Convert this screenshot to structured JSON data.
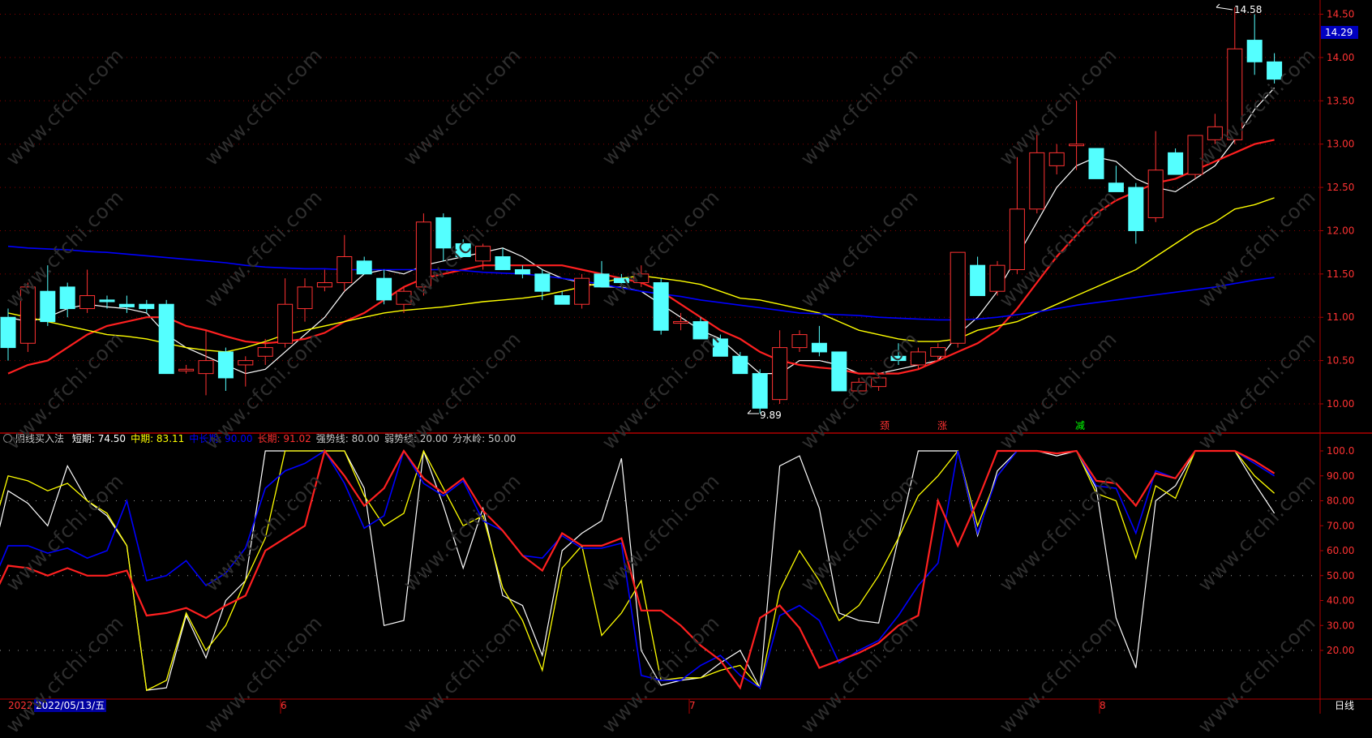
{
  "watermark": "www.cfchi.com",
  "price_axis": {
    "ticks": [
      "14.50",
      "14.00",
      "13.50",
      "13.00",
      "12.50",
      "12.00",
      "11.50",
      "11.00",
      "10.50",
      "10.00"
    ],
    "current": "14.29"
  },
  "osc_axis": {
    "ticks": [
      "100.0",
      "90.00",
      "80.00",
      "70.00",
      "60.00",
      "50.00",
      "40.00",
      "30.00",
      "20.00"
    ]
  },
  "labels": {
    "high": "14.58",
    "low": "9.89"
  },
  "signals": [
    "颈",
    "涨",
    "减"
  ],
  "indicator": {
    "name": "阴线买入法",
    "items": [
      {
        "label": "短期:",
        "value": "74.50",
        "color": "#ffffff"
      },
      {
        "label": "中期:",
        "value": "83.11",
        "color": "#ffff00"
      },
      {
        "label": "中长期:",
        "value": "90.00",
        "color": "#0000ff"
      },
      {
        "label": "长期:",
        "value": "91.02",
        "color": "#ff3030"
      },
      {
        "label": "强势线:",
        "value": "80.00",
        "color": "#c8c8c8"
      },
      {
        "label": "弱势线:",
        "value": "20.00",
        "color": "#c8c8c8"
      },
      {
        "label": "分水岭:",
        "value": "50.00",
        "color": "#c8c8c8"
      }
    ]
  },
  "footer": {
    "year": "2022",
    "cursor_date": "2022/05/13/五",
    "months": [
      "6",
      "7",
      "8"
    ],
    "period": "日线"
  },
  "colors": {
    "up": "#ff3232",
    "down": "#54ffff",
    "ma5": "#ffffff",
    "ma10": "#ff2020",
    "ma20": "#ffff00",
    "ma60": "#0000ff",
    "grid": "#8b0000"
  },
  "chart_data": [
    {
      "type": "candlestick",
      "title": "",
      "ylim": [
        9.8,
        14.6
      ],
      "candles": [
        {
          "o": 11.0,
          "h": 11.1,
          "l": 10.5,
          "c": 10.65
        },
        {
          "o": 10.7,
          "h": 11.4,
          "l": 10.6,
          "c": 11.35
        },
        {
          "o": 11.3,
          "h": 11.6,
          "l": 10.9,
          "c": 10.95
        },
        {
          "o": 11.35,
          "h": 11.4,
          "l": 11.0,
          "c": 11.1
        },
        {
          "o": 11.1,
          "h": 11.55,
          "l": 11.05,
          "c": 11.25
        },
        {
          "o": 11.2,
          "h": 11.25,
          "l": 11.1,
          "c": 11.18
        },
        {
          "o": 11.15,
          "h": 11.25,
          "l": 11.05,
          "c": 11.12
        },
        {
          "o": 11.15,
          "h": 11.2,
          "l": 11.05,
          "c": 11.1
        },
        {
          "o": 11.15,
          "h": 11.2,
          "l": 10.35,
          "c": 10.35
        },
        {
          "o": 10.4,
          "h": 10.45,
          "l": 10.35,
          "c": 10.4
        },
        {
          "o": 10.35,
          "h": 10.85,
          "l": 10.1,
          "c": 10.5
        },
        {
          "o": 10.6,
          "h": 10.65,
          "l": 10.15,
          "c": 10.3
        },
        {
          "o": 10.45,
          "h": 10.55,
          "l": 10.2,
          "c": 10.5
        },
        {
          "o": 10.55,
          "h": 10.75,
          "l": 10.45,
          "c": 10.65
        },
        {
          "o": 10.7,
          "h": 11.45,
          "l": 10.65,
          "c": 11.15
        },
        {
          "o": 11.1,
          "h": 11.45,
          "l": 10.95,
          "c": 11.35
        },
        {
          "o": 11.35,
          "h": 11.55,
          "l": 11.3,
          "c": 11.4
        },
        {
          "o": 11.4,
          "h": 11.95,
          "l": 11.3,
          "c": 11.7
        },
        {
          "o": 11.65,
          "h": 11.7,
          "l": 11.5,
          "c": 11.5
        },
        {
          "o": 11.45,
          "h": 11.55,
          "l": 11.15,
          "c": 11.2
        },
        {
          "o": 11.15,
          "h": 11.35,
          "l": 11.05,
          "c": 11.3
        },
        {
          "o": 11.35,
          "h": 12.2,
          "l": 11.25,
          "c": 12.1
        },
        {
          "o": 12.15,
          "h": 12.2,
          "l": 11.65,
          "c": 11.8
        },
        {
          "o": 11.85,
          "h": 11.9,
          "l": 11.7,
          "c": 11.7
        },
        {
          "o": 11.65,
          "h": 11.85,
          "l": 11.55,
          "c": 11.82
        },
        {
          "o": 11.7,
          "h": 11.8,
          "l": 11.55,
          "c": 11.55
        },
        {
          "o": 11.55,
          "h": 11.6,
          "l": 11.45,
          "c": 11.5
        },
        {
          "o": 11.5,
          "h": 11.55,
          "l": 11.2,
          "c": 11.3
        },
        {
          "o": 11.25,
          "h": 11.3,
          "l": 11.15,
          "c": 11.15
        },
        {
          "o": 11.15,
          "h": 11.5,
          "l": 11.1,
          "c": 11.45
        },
        {
          "o": 11.5,
          "h": 11.65,
          "l": 11.35,
          "c": 11.35
        },
        {
          "o": 11.45,
          "h": 11.5,
          "l": 11.35,
          "c": 11.4
        },
        {
          "o": 11.4,
          "h": 11.6,
          "l": 11.35,
          "c": 11.5
        },
        {
          "o": 11.4,
          "h": 11.45,
          "l": 10.8,
          "c": 10.85
        },
        {
          "o": 10.95,
          "h": 11.05,
          "l": 10.85,
          "c": 10.95
        },
        {
          "o": 10.95,
          "h": 11.0,
          "l": 10.75,
          "c": 10.75
        },
        {
          "o": 10.75,
          "h": 10.8,
          "l": 10.55,
          "c": 10.55
        },
        {
          "o": 10.55,
          "h": 10.6,
          "l": 10.35,
          "c": 10.35
        },
        {
          "o": 10.35,
          "h": 10.4,
          "l": 9.89,
          "c": 9.95
        },
        {
          "o": 10.05,
          "h": 10.85,
          "l": 10.0,
          "c": 10.65
        },
        {
          "o": 10.65,
          "h": 10.85,
          "l": 10.6,
          "c": 10.8
        },
        {
          "o": 10.7,
          "h": 10.9,
          "l": 10.55,
          "c": 10.6
        },
        {
          "o": 10.6,
          "h": 10.6,
          "l": 10.15,
          "c": 10.15
        },
        {
          "o": 10.15,
          "h": 10.3,
          "l": 10.15,
          "c": 10.25
        },
        {
          "o": 10.2,
          "h": 10.35,
          "l": 10.15,
          "c": 10.3
        },
        {
          "o": 10.55,
          "h": 10.7,
          "l": 10.45,
          "c": 10.5
        },
        {
          "o": 10.45,
          "h": 10.65,
          "l": 10.4,
          "c": 10.6
        },
        {
          "o": 10.55,
          "h": 10.7,
          "l": 10.5,
          "c": 10.65
        },
        {
          "o": 10.7,
          "h": 11.75,
          "l": 10.65,
          "c": 11.75
        },
        {
          "o": 11.6,
          "h": 11.7,
          "l": 11.25,
          "c": 11.25
        },
        {
          "o": 11.3,
          "h": 11.65,
          "l": 11.25,
          "c": 11.6
        },
        {
          "o": 11.55,
          "h": 12.85,
          "l": 11.5,
          "c": 12.25
        },
        {
          "o": 12.25,
          "h": 13.15,
          "l": 12.2,
          "c": 12.9
        },
        {
          "o": 12.75,
          "h": 13.0,
          "l": 12.65,
          "c": 12.9
        },
        {
          "o": 13.0,
          "h": 13.5,
          "l": 12.7,
          "c": 13.0
        },
        {
          "o": 12.95,
          "h": 12.95,
          "l": 12.6,
          "c": 12.6
        },
        {
          "o": 12.55,
          "h": 12.75,
          "l": 12.45,
          "c": 12.45
        },
        {
          "o": 12.5,
          "h": 12.55,
          "l": 11.85,
          "c": 12.0
        },
        {
          "o": 12.15,
          "h": 13.15,
          "l": 12.1,
          "c": 12.7
        },
        {
          "o": 12.9,
          "h": 12.95,
          "l": 12.65,
          "c": 12.65
        },
        {
          "o": 12.65,
          "h": 13.1,
          "l": 12.6,
          "c": 13.1
        },
        {
          "o": 13.05,
          "h": 13.35,
          "l": 13.0,
          "c": 13.2
        },
        {
          "o": 13.05,
          "h": 14.58,
          "l": 13.0,
          "c": 14.1
        },
        {
          "o": 14.2,
          "h": 14.5,
          "l": 13.8,
          "c": 13.95
        },
        {
          "o": 13.95,
          "h": 14.05,
          "l": 13.7,
          "c": 13.75
        }
      ],
      "series": [
        {
          "values": [
            11.0,
            10.95,
            11.0,
            11.1,
            11.15,
            11.12,
            11.1,
            11.05,
            10.8,
            10.65,
            10.55,
            10.45,
            10.35,
            10.4,
            10.6,
            10.8,
            11.0,
            11.3,
            11.5,
            11.55,
            11.5,
            11.6,
            11.65,
            11.7,
            11.75,
            11.8,
            11.7,
            11.55,
            11.45,
            11.4,
            11.35,
            11.35,
            11.3,
            11.15,
            11.0,
            10.85,
            10.75,
            10.55,
            10.35,
            10.35,
            10.5,
            10.5,
            10.45,
            10.35,
            10.35,
            10.4,
            10.45,
            10.5,
            10.8,
            11.0,
            11.3,
            11.7,
            12.1,
            12.5,
            12.75,
            12.85,
            12.8,
            12.6,
            12.5,
            12.45,
            12.6,
            12.75,
            13.05,
            13.4,
            13.65
          ]
        },
        {
          "values": [
            10.35,
            10.45,
            10.5,
            10.65,
            10.8,
            10.9,
            10.95,
            11.0,
            11.0,
            10.9,
            10.85,
            10.78,
            10.72,
            10.7,
            10.72,
            10.75,
            10.82,
            10.95,
            11.05,
            11.2,
            11.35,
            11.45,
            11.5,
            11.55,
            11.6,
            11.6,
            11.6,
            11.6,
            11.6,
            11.55,
            11.5,
            11.45,
            11.4,
            11.3,
            11.15,
            11.0,
            10.85,
            10.75,
            10.6,
            10.5,
            10.45,
            10.42,
            10.4,
            10.35,
            10.35,
            10.35,
            10.4,
            10.5,
            10.6,
            10.7,
            10.85,
            11.1,
            11.4,
            11.7,
            11.95,
            12.2,
            12.35,
            12.45,
            12.55,
            12.6,
            12.7,
            12.8,
            12.9,
            13.0,
            13.05
          ]
        },
        {
          "values": [
            11.05,
            11.0,
            10.95,
            10.9,
            10.85,
            10.8,
            10.78,
            10.75,
            10.7,
            10.65,
            10.62,
            10.6,
            10.65,
            10.72,
            10.8,
            10.85,
            10.9,
            10.95,
            11.0,
            11.05,
            11.08,
            11.1,
            11.12,
            11.15,
            11.18,
            11.2,
            11.22,
            11.25,
            11.3,
            11.35,
            11.4,
            11.45,
            11.48,
            11.45,
            11.42,
            11.38,
            11.3,
            11.22,
            11.2,
            11.15,
            11.1,
            11.05,
            10.95,
            10.85,
            10.8,
            10.75,
            10.72,
            10.72,
            10.75,
            10.85,
            10.9,
            10.95,
            11.05,
            11.15,
            11.25,
            11.35,
            11.45,
            11.55,
            11.7,
            11.85,
            12.0,
            12.1,
            12.25,
            12.3,
            12.38
          ]
        },
        {
          "values": [
            11.82,
            11.8,
            11.79,
            11.78,
            11.76,
            11.75,
            11.73,
            11.71,
            11.69,
            11.67,
            11.65,
            11.63,
            11.6,
            11.58,
            11.57,
            11.56,
            11.56,
            11.55,
            11.55,
            11.55,
            11.55,
            11.55,
            11.55,
            11.54,
            11.52,
            11.51,
            11.5,
            11.48,
            11.45,
            11.42,
            11.38,
            11.34,
            11.3,
            11.27,
            11.24,
            11.2,
            11.17,
            11.14,
            11.11,
            11.08,
            11.05,
            11.04,
            11.03,
            11.02,
            11.0,
            10.99,
            10.98,
            10.97,
            10.97,
            10.98,
            11.0,
            11.03,
            11.06,
            11.1,
            11.14,
            11.17,
            11.2,
            11.23,
            11.26,
            11.29,
            11.32,
            11.35,
            11.39,
            11.43,
            11.46
          ]
        }
      ]
    },
    {
      "type": "line",
      "title": "",
      "ylim": [
        0,
        100
      ],
      "series": [
        {
          "name": "短期",
          "values": [
            50,
            84,
            79,
            70,
            94,
            80,
            74,
            62,
            4,
            5,
            34,
            17,
            40,
            48,
            100,
            100,
            100,
            100,
            100,
            85,
            30,
            32,
            100,
            78,
            53,
            77,
            42,
            38,
            18,
            60,
            67,
            72,
            97,
            20,
            6,
            8,
            9,
            15,
            20,
            5,
            94,
            98,
            77,
            35,
            32,
            31,
            65,
            100,
            100,
            100,
            66,
            92,
            100,
            100,
            98,
            100,
            85,
            33,
            13,
            80,
            86,
            100,
            100,
            100,
            87,
            75
          ]
        },
        {
          "name": "中期",
          "values": [
            62,
            90,
            88,
            84,
            87,
            80,
            75,
            62,
            4,
            8,
            35,
            20,
            30,
            48,
            65,
            100,
            100,
            100,
            100,
            82,
            70,
            75,
            100,
            85,
            70,
            74,
            45,
            32,
            12,
            53,
            62,
            26,
            35,
            48,
            8,
            9,
            9,
            12,
            14,
            5,
            44,
            60,
            48,
            32,
            38,
            50,
            65,
            82,
            90,
            100,
            70,
            90,
            100,
            100,
            99,
            100,
            83,
            80,
            57,
            86,
            81,
            100,
            100,
            100,
            90,
            83
          ]
        },
        {
          "name": "中长期",
          "values": [
            43,
            62,
            62,
            59,
            61,
            57,
            60,
            80,
            48,
            50,
            56,
            46,
            51,
            61,
            85,
            92,
            95,
            100,
            87,
            69,
            74,
            100,
            87,
            82,
            88,
            72,
            68,
            58,
            57,
            66,
            61,
            61,
            63,
            10,
            8,
            8,
            14,
            18,
            10,
            5,
            34,
            38,
            32,
            15,
            20,
            24,
            34,
            46,
            55,
            100,
            67,
            90,
            100,
            100,
            99,
            100,
            86,
            85,
            67,
            92,
            89,
            100,
            100,
            100,
            95,
            90
          ]
        },
        {
          "name": "长期",
          "values": [
            37,
            54,
            53,
            50,
            53,
            50,
            50,
            52,
            34,
            35,
            37,
            33,
            38,
            42,
            60,
            65,
            70,
            100,
            90,
            78,
            85,
            100,
            89,
            83,
            89,
            76,
            68,
            58,
            52,
            67,
            62,
            62,
            65,
            36,
            36,
            30,
            22,
            16,
            5,
            33,
            38,
            29,
            13,
            16,
            19,
            23,
            30,
            34,
            80,
            62,
            80,
            100,
            100,
            100,
            99,
            100,
            88,
            87,
            78,
            91,
            89,
            100,
            100,
            100,
            96,
            91
          ]
        }
      ]
    }
  ]
}
